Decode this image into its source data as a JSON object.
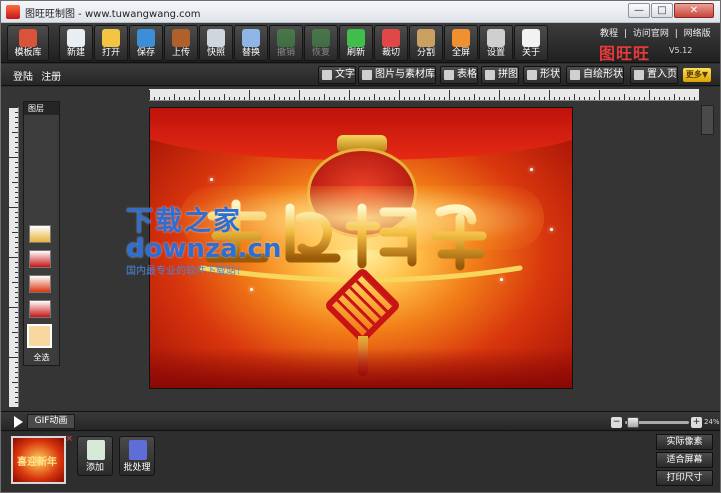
{
  "window": {
    "title": "图旺旺制图 - www.tuwangwang.com",
    "controls": {
      "minimize": "—",
      "maximize": "□",
      "close": "✕"
    }
  },
  "toolbar": {
    "buttons": [
      {
        "label": "模板库",
        "icon": "template-library-icon",
        "color": "#d9523a",
        "enabled": true
      },
      {
        "label": "新建",
        "icon": "new-document-icon",
        "color": "#e9eef5",
        "enabled": true
      },
      {
        "label": "打开",
        "icon": "open-folder-icon",
        "color": "#f4c542",
        "enabled": true
      },
      {
        "label": "保存",
        "icon": "save-disk-icon",
        "color": "#3b8fd9",
        "enabled": true
      },
      {
        "label": "上传",
        "icon": "upload-icon",
        "color": "#b0602a",
        "enabled": true
      },
      {
        "label": "快照",
        "icon": "snapshot-icon",
        "color": "#cfd6de",
        "enabled": true
      },
      {
        "label": "替换",
        "icon": "replace-icon",
        "color": "#8fb6e6",
        "enabled": true
      },
      {
        "label": "撤销",
        "icon": "undo-icon",
        "color": "#4caf50",
        "enabled": false
      },
      {
        "label": "恢复",
        "icon": "redo-icon",
        "color": "#4caf50",
        "enabled": false
      },
      {
        "label": "刷新",
        "icon": "refresh-icon",
        "color": "#3fbf4a",
        "enabled": true
      },
      {
        "label": "裁切",
        "icon": "crop-scissors-icon",
        "color": "#e04848",
        "enabled": true
      },
      {
        "label": "分割",
        "icon": "split-knife-icon",
        "color": "#caa060",
        "enabled": true
      },
      {
        "label": "全屏",
        "icon": "fullscreen-icon",
        "color": "#f09030",
        "enabled": true
      },
      {
        "label": "设置",
        "icon": "settings-gear-icon",
        "color": "#cfcfcf",
        "enabled": true
      },
      {
        "label": "关于",
        "icon": "about-question-icon",
        "color": "#f2f2f2",
        "enabled": true
      }
    ],
    "links": [
      "教程",
      "|",
      "访问官网",
      "|",
      "网络版"
    ],
    "logo": "图旺旺",
    "version": "V5.12"
  },
  "subbar": {
    "login": "登陆",
    "register": "注册",
    "tools": [
      {
        "label": "文字",
        "icon": "text-a-icon"
      },
      {
        "label": "图片与素材库",
        "icon": "image-library-icon"
      },
      {
        "label": "表格",
        "icon": "table-grid-icon"
      },
      {
        "label": "拼图",
        "icon": "collage-icon"
      },
      {
        "label": "形状",
        "icon": "shape-arrow-icon"
      },
      {
        "label": "自绘形状",
        "icon": "custom-shape-pen-icon"
      },
      {
        "label": "置入页",
        "icon": "insert-page-icon"
      }
    ],
    "more": "更多▼"
  },
  "layers": {
    "title": "图层",
    "select_all": "全选",
    "items": [
      {
        "name": "layer-ornament-gold",
        "color": "#e8b33a"
      },
      {
        "name": "layer-knot-small",
        "color": "#c81414"
      },
      {
        "name": "layer-lantern",
        "color": "#d8360d"
      },
      {
        "name": "layer-diamond",
        "color": "#c81414"
      },
      {
        "name": "layer-background",
        "color": "#f17d18",
        "selected": true
      }
    ]
  },
  "canvas": {
    "artwork_text": "喜迎新年"
  },
  "watermark": {
    "cn": "下载之家",
    "en": "downza.cn",
    "sub": "国内最专业的软件下载站！"
  },
  "gifbar": {
    "label": "GIF动画",
    "zoom_minus": "−",
    "zoom_plus": "+",
    "zoom_value": "24%"
  },
  "bottom": {
    "frame_text": "喜迎新年",
    "frame_close": "×",
    "buttons": [
      {
        "label": "添加",
        "icon": "add-page-icon",
        "color": "#d6e9d6"
      },
      {
        "label": "批处理",
        "icon": "batch-process-icon",
        "color": "#5f6dd8"
      }
    ],
    "right_buttons": [
      "实际像素",
      "适合屏幕",
      "打印尺寸"
    ]
  }
}
